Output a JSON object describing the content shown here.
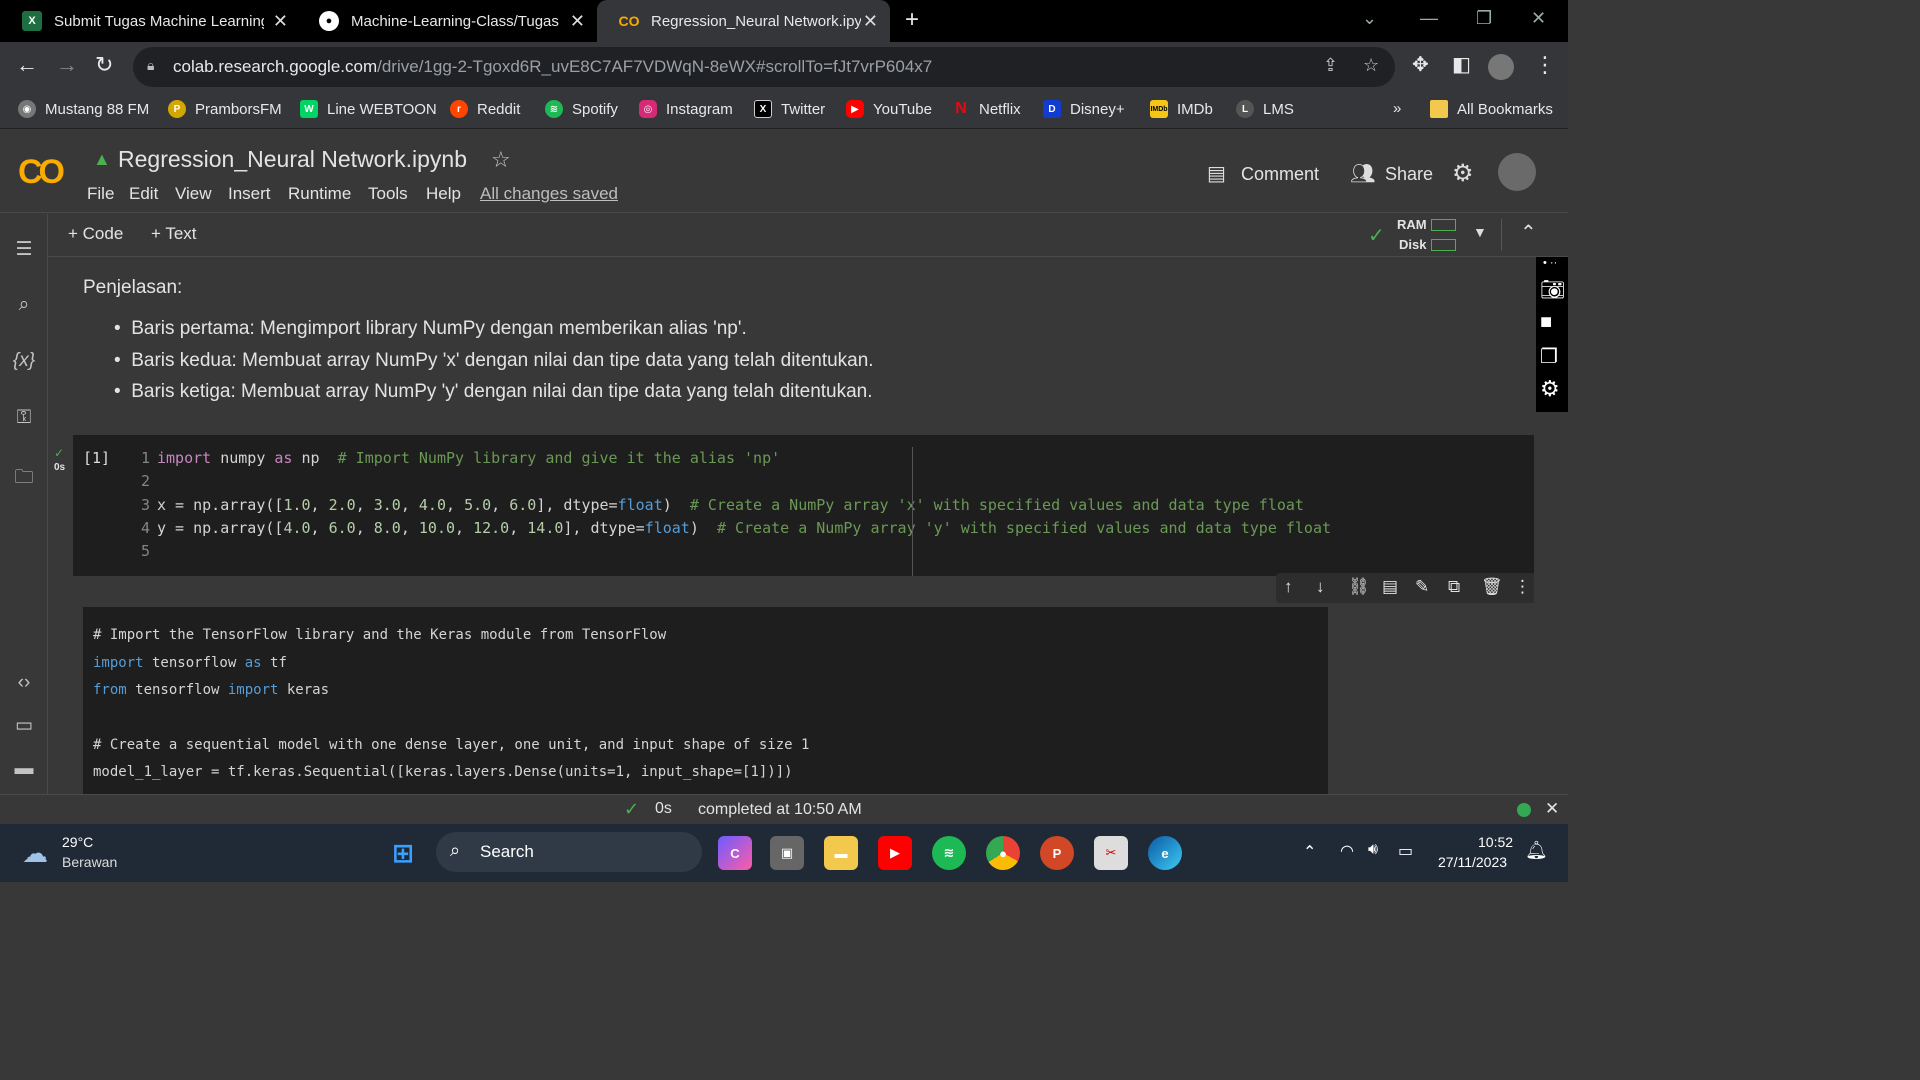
{
  "tabs": [
    {
      "title": "Submit Tugas Machine Learning",
      "icon": "excel-icon"
    },
    {
      "title": "Machine-Learning-Class/Tugas",
      "icon": "github-icon"
    },
    {
      "title": "Regression_Neural Network.ipyn",
      "icon": "colab-icon",
      "active": true
    }
  ],
  "url": {
    "host": "colab.research.google.com",
    "path": "/drive/1gg-2-Tgoxd6R_uvE8C7AF7VDWqN-8eWX#scrollTo=fJt7vrP604x7"
  },
  "bookmarks": [
    "Mustang 88 FM",
    "PramborsFM",
    "Line WEBTOON",
    "Reddit",
    "Spotify",
    "Instagram",
    "Twitter",
    "YouTube",
    "Netflix",
    "Disney+",
    "IMDb",
    "LMS"
  ],
  "all_bookmarks": "All Bookmarks",
  "colab": {
    "logo": "CO",
    "title": "Regression_Neural Network.ipynb",
    "menu": [
      "File",
      "Edit",
      "View",
      "Insert",
      "Runtime",
      "Tools",
      "Help"
    ],
    "saved": "All changes saved",
    "comment": "Comment",
    "share": "Share",
    "add_code": "+ Code",
    "add_text": "+ Text",
    "ram": "RAM",
    "disk": "Disk"
  },
  "markdown": {
    "heading": "Penjelasan:",
    "bullets": [
      "Baris pertama: Mengimport library NumPy dengan memberikan alias 'np'.",
      "Baris kedua: Membuat array NumPy 'x' dengan nilai dan tipe data yang telah ditentukan.",
      "Baris ketiga: Membuat array NumPy 'y' dengan nilai dan tipe data yang telah ditentukan."
    ]
  },
  "cell1": {
    "exec": "[1]",
    "time": "0s",
    "lines": [
      "1",
      "2",
      "3",
      "4",
      "5"
    ]
  },
  "cell2": {
    "lines": [
      "# Import the TensorFlow library and the Keras module from TensorFlow",
      "import tensorflow as tf",
      "from tensorflow import keras",
      "",
      "# Create a sequential model with one dense layer, one unit, and input shape of size 1",
      "model_1_layer = tf.keras.Sequential([keras.layers.Dense(units=1, input_shape=[1])])"
    ]
  },
  "status": {
    "time": "0s",
    "text": "completed at 10:50 AM"
  },
  "taskbar": {
    "temp": "29°C",
    "weather": "Berawan",
    "search": "Search",
    "time": "10:52",
    "date": "27/11/2023"
  }
}
